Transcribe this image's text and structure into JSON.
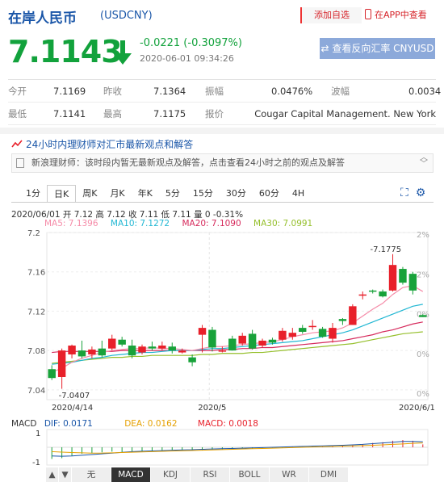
{
  "header": {
    "title": "在岸人民币",
    "code": "(USDCNY)",
    "add_favorite": "添加自选",
    "app_view": "在APP中查看"
  },
  "quote": {
    "price": "7.1143",
    "change": "-0.0221 (-0.3097%)",
    "timestamp": "2020-06-01 09:34:26",
    "reverse_button": "查看反向汇率 CNYUSD"
  },
  "stats": {
    "open_label": "今开",
    "open": "7.1169",
    "prev_close_label": "昨收",
    "prev_close": "7.1364",
    "amplitude_label": "振幅",
    "amplitude": "0.0476%",
    "wave_label": "波幅",
    "wave": "0.0034",
    "low_label": "最低",
    "low": "7.1141",
    "high_label": "最高",
    "high": "7.1175",
    "quote_label": "报价",
    "quoter": "Cougar Capital Management. New York"
  },
  "news": {
    "heading": "24小时内理财师对汇市最新观点和解答",
    "message": "新浪理财师：该时段内暂无最新观点及解答，点击查看24小时之前的观点及解答"
  },
  "tabs": [
    "1分",
    "日K",
    "周K",
    "月K",
    "年K",
    "5分",
    "15分",
    "30分",
    "60分",
    "4H"
  ],
  "active_tab": "日K",
  "chart_info": {
    "ohlc_line": "2020/06/01 开 7.12 高 7.12 收 7.11 低 7.11 量 0 -0.31%",
    "ma5": "MA5: 7.1396",
    "ma10": "MA10: 7.1272",
    "ma20": "MA20: 7.1090",
    "ma30": "MA30: 7.0991",
    "macd_label": "MACD",
    "dif": "DIF: 0.0171",
    "dea": "DEA: 0.0162",
    "macd": "MACD: 0.0018"
  },
  "colors": {
    "up": "#e8202a",
    "down": "#18a23a",
    "ma5": "#f58ba8",
    "ma10": "#21b7d3",
    "ma20": "#d62a5c",
    "ma30": "#95bf2b",
    "accent": "#1a56a8"
  },
  "chart_data": {
    "type": "candlestick",
    "y_ticks": [
      "7.2",
      "7.16",
      "7.12",
      "7.08",
      "7.04"
    ],
    "right_ticks": [
      "2%",
      "2%",
      "0%",
      "0%",
      "0%"
    ],
    "x_labels": [
      "2020/4/14",
      "2020/5",
      "2020/6/1"
    ],
    "high_annotation": "7.1775",
    "low_annotation": "7.0407",
    "ylim": [
      7.03,
      7.2
    ],
    "candles": [
      [
        7.061,
        7.052,
        7.065,
        7.05
      ],
      [
        7.053,
        7.08,
        7.082,
        7.041
      ],
      [
        7.076,
        7.085,
        7.086,
        7.072
      ],
      [
        7.08,
        7.074,
        7.09,
        7.072
      ],
      [
        7.076,
        7.081,
        7.084,
        7.072
      ],
      [
        7.082,
        7.075,
        7.09,
        7.073
      ],
      [
        7.082,
        7.092,
        7.096,
        7.08
      ],
      [
        7.091,
        7.086,
        7.094,
        7.084
      ],
      [
        7.085,
        7.075,
        7.091,
        7.072
      ],
      [
        7.078,
        7.084,
        7.086,
        7.076
      ],
      [
        7.084,
        7.082,
        7.089,
        7.08
      ],
      [
        7.082,
        7.085,
        7.089,
        7.08
      ],
      [
        7.084,
        7.08,
        7.088,
        7.077
      ],
      [
        7.078,
        7.08,
        7.082,
        7.077
      ],
      [
        7.073,
        7.068,
        7.076,
        7.064
      ],
      [
        7.096,
        7.103,
        7.106,
        7.078
      ],
      [
        7.101,
        7.083,
        7.104,
        7.079
      ],
      [
        7.08,
        7.08,
        7.084,
        7.078
      ],
      [
        7.092,
        7.08,
        7.095,
        7.08
      ],
      [
        7.087,
        7.095,
        7.098,
        7.085
      ],
      [
        7.097,
        7.082,
        7.101,
        7.081
      ],
      [
        7.085,
        7.09,
        7.092,
        7.083
      ],
      [
        7.091,
        7.088,
        7.093,
        7.086
      ],
      [
        7.091,
        7.1,
        7.103,
        7.089
      ],
      [
        7.094,
        7.098,
        7.103,
        7.091
      ],
      [
        7.103,
        7.099,
        7.106,
        7.097
      ],
      [
        7.104,
        7.105,
        7.111,
        7.101
      ],
      [
        7.102,
        7.094,
        7.104,
        7.093
      ],
      [
        7.092,
        7.103,
        7.108,
        7.088
      ],
      [
        7.112,
        7.11,
        7.113,
        7.106
      ],
      [
        7.106,
        7.125,
        7.127,
        7.106
      ],
      [
        7.136,
        7.137,
        7.14,
        7.132
      ],
      [
        7.141,
        7.14,
        7.142,
        7.138
      ],
      [
        7.14,
        7.135,
        7.142,
        7.134
      ],
      [
        7.141,
        7.167,
        7.178,
        7.14
      ],
      [
        7.163,
        7.149,
        7.165,
        7.147
      ],
      [
        7.158,
        7.141,
        7.16,
        7.137
      ],
      [
        7.116,
        7.114,
        7.117,
        7.114
      ]
    ],
    "ma5": [
      7.058,
      7.062,
      7.068,
      7.072,
      7.075,
      7.078,
      7.08,
      7.081,
      7.082,
      7.082,
      7.083,
      7.082,
      7.082,
      7.081,
      7.08,
      7.082,
      7.084,
      7.084,
      7.085,
      7.086,
      7.087,
      7.088,
      7.089,
      7.091,
      7.094,
      7.096,
      7.098,
      7.099,
      7.1,
      7.103,
      7.108,
      7.115,
      7.122,
      7.128,
      7.137,
      7.144,
      7.146,
      7.14
    ],
    "ma10": [
      7.066,
      7.067,
      7.068,
      7.07,
      7.072,
      7.073,
      7.075,
      7.076,
      7.077,
      7.078,
      7.078,
      7.079,
      7.08,
      7.08,
      7.08,
      7.081,
      7.082,
      7.082,
      7.083,
      7.084,
      7.085,
      7.086,
      7.087,
      7.088,
      7.089,
      7.09,
      7.092,
      7.094,
      7.096,
      7.098,
      7.101,
      7.105,
      7.109,
      7.113,
      7.117,
      7.121,
      7.125,
      7.127
    ],
    "ma20": [
      7.078,
      7.079,
      7.079,
      7.079,
      7.079,
      7.079,
      7.079,
      7.08,
      7.08,
      7.08,
      7.08,
      7.08,
      7.08,
      7.08,
      7.08,
      7.08,
      7.08,
      7.081,
      7.081,
      7.082,
      7.082,
      7.083,
      7.083,
      7.084,
      7.085,
      7.086,
      7.087,
      7.088,
      7.089,
      7.09,
      7.092,
      7.094,
      7.096,
      7.099,
      7.101,
      7.104,
      7.107,
      7.109
    ],
    "ma30": [
      7.067,
      7.068,
      7.069,
      7.07,
      7.071,
      7.072,
      7.073,
      7.073,
      7.074,
      7.074,
      7.075,
      7.075,
      7.075,
      7.075,
      7.075,
      7.076,
      7.076,
      7.077,
      7.077,
      7.077,
      7.078,
      7.078,
      7.079,
      7.08,
      7.081,
      7.082,
      7.083,
      7.084,
      7.085,
      7.086,
      7.087,
      7.089,
      7.091,
      7.093,
      7.095,
      7.097,
      7.098,
      7.099
    ],
    "macd_y_ticks": [
      "1",
      "-1"
    ],
    "macd_hist": [
      -0.8,
      -0.75,
      -0.6,
      -0.45,
      -0.4,
      -0.35,
      -0.3,
      -0.32,
      -0.28,
      -0.25,
      -0.22,
      -0.2,
      -0.18,
      -0.2,
      -0.25,
      -0.22,
      -0.18,
      -0.15,
      -0.12,
      -0.1,
      -0.08,
      -0.05,
      -0.04,
      -0.02,
      0.02,
      0.04,
      0.05,
      0.06,
      0.07,
      0.1,
      0.15,
      0.2,
      0.3,
      0.35,
      0.45,
      0.5,
      0.45,
      0.2
    ],
    "dif": [
      -0.6,
      -0.62,
      -0.6,
      -0.55,
      -0.5,
      -0.45,
      -0.4,
      -0.35,
      -0.3,
      -0.27,
      -0.25,
      -0.23,
      -0.2,
      -0.18,
      -0.17,
      -0.14,
      -0.12,
      -0.1,
      -0.08,
      -0.06,
      -0.04,
      -0.02,
      0.0,
      0.02,
      0.04,
      0.06,
      0.08,
      0.1,
      0.12,
      0.14,
      0.17,
      0.2,
      0.25,
      0.3,
      0.35,
      0.4,
      0.4,
      0.38
    ],
    "dea": [
      -0.3,
      -0.33,
      -0.36,
      -0.38,
      -0.4,
      -0.4,
      -0.38,
      -0.36,
      -0.34,
      -0.32,
      -0.3,
      -0.28,
      -0.26,
      -0.24,
      -0.22,
      -0.2,
      -0.18,
      -0.16,
      -0.14,
      -0.12,
      -0.1,
      -0.08,
      -0.06,
      -0.04,
      -0.02,
      0.0,
      0.02,
      0.04,
      0.06,
      0.08,
      0.1,
      0.12,
      0.14,
      0.17,
      0.2,
      0.23,
      0.27,
      0.3
    ]
  },
  "bottom_tabs": [
    "无",
    "MACD",
    "KDJ",
    "RSI",
    "BOLL",
    "WR",
    "DMI"
  ],
  "active_bottom": "MACD"
}
